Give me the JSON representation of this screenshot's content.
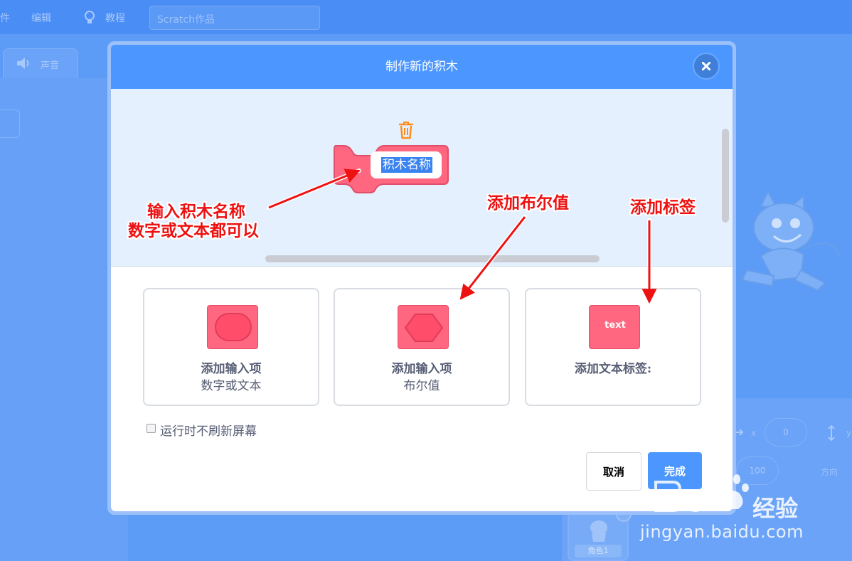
{
  "editor": {
    "menu": [
      "件",
      "编辑",
      "教程"
    ],
    "project_title": "Scratch作品",
    "sound_tab": "声音",
    "sprite_x_label": "x",
    "sprite_x_value": "0",
    "sprite_y_label": "y",
    "size_value": "100",
    "direction_label": "方向",
    "sprite_name": "角色1"
  },
  "modal": {
    "title": "制作新的积木",
    "block_name": "积木名称",
    "options": [
      {
        "title": "添加输入项",
        "subtitle": "数字或文本"
      },
      {
        "title": "添加输入项",
        "subtitle": "布尔值"
      },
      {
        "title": "添加文本标签:",
        "icon_text": "text"
      }
    ],
    "checkbox_label": "运行时不刷新屏幕",
    "cancel_label": "取消",
    "done_label": "完成"
  },
  "annotations": {
    "name_line1": "输入积木名称",
    "name_line2": "数字或文本都可以",
    "boolean": "添加布尔值",
    "label": "添加标签"
  },
  "watermark": {
    "brand": "经验",
    "url": "jingyan.baidu.com"
  },
  "colors": {
    "header_blue": "#4c97ff",
    "block_pink": "#ff6680",
    "annotation_red": "#ee1111"
  }
}
